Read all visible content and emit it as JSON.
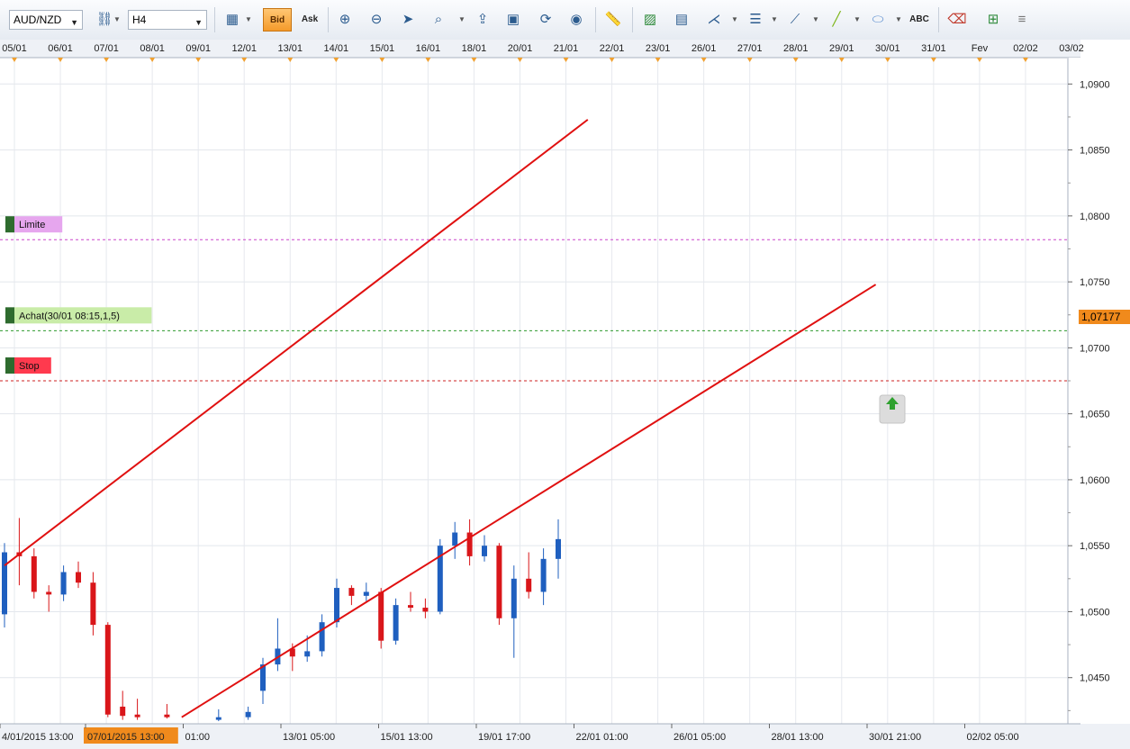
{
  "toolbar": {
    "symbol": "AUD/NZD",
    "timeframe": "H4",
    "bid_label": "Bid",
    "ask_label": "Ask",
    "text_tool_label": "ABC",
    "icons": [
      "symbol-dropdown-icon",
      "link-icon",
      "timeframe-dropdown-icon",
      "chart-type-icon",
      "bid-button",
      "ask-button",
      "zoom-in-icon",
      "zoom-out-icon",
      "cursor-icon",
      "crosshair-icon",
      "trend-tool-icon",
      "screenshot-icon",
      "refresh-icon",
      "globe-icon",
      "ruler-icon",
      "image-icon",
      "template-icon",
      "fork-icon",
      "indicators-icon",
      "draw-line-icon",
      "pencil-icon",
      "ellipse-icon",
      "text-tool-icon",
      "eraser-icon",
      "hierarchy-icon",
      "menu-icon"
    ]
  },
  "chart_data": {
    "type": "candlestick",
    "symbol": "AUD/NZD",
    "timeframe": "H4",
    "ylim": [
      1.0415,
      1.092
    ],
    "y_ticks": [
      "1,0900",
      "1,0850",
      "1,0800",
      "1,0750",
      "1,0700",
      "1,0650",
      "1,0600",
      "1,0550",
      "1,0500",
      "1,0450"
    ],
    "top_date_labels": [
      "05/01",
      "06/01",
      "07/01",
      "08/01",
      "09/01",
      "12/01",
      "13/01",
      "14/01",
      "15/01",
      "16/01",
      "18/01",
      "20/01",
      "21/01",
      "22/01",
      "23/01",
      "26/01",
      "27/01",
      "28/01",
      "29/01",
      "30/01",
      "31/01",
      "Fev",
      "02/02",
      "03/02"
    ],
    "bottom_time_labels": [
      "4/01/2015 13:00",
      "07/01/2015 13:00",
      "01:00",
      "13/01 05:00",
      "15/01 13:00",
      "19/01 17:00",
      "22/01 01:00",
      "26/01 05:00",
      "28/01 13:00",
      "30/01 21:00",
      "02/02 05:00"
    ],
    "highlighted_time": "07/01/2015 13:00",
    "current_price": "1,07177",
    "order_lines": [
      {
        "label": "Limite",
        "price": 1.0782,
        "color": "#cc44cc",
        "tag_bg": "#e6a6ee"
      },
      {
        "label": "Achat(30/01 08:15,1,5)",
        "price": 1.0713,
        "color": "#2e9a2e",
        "tag_bg": "#c9eca8"
      },
      {
        "label": "Stop",
        "price": 1.0675,
        "color": "#cc2222",
        "tag_bg": "#ff3a4e"
      }
    ],
    "trend_lines": [
      {
        "name": "upper-channel",
        "from": {
          "x": 0,
          "p": 1.0535
        },
        "to": {
          "x": 158,
          "p": 1.0873
        }
      },
      {
        "name": "lower-channel",
        "from": {
          "x": 48,
          "p": 1.042
        },
        "to": {
          "x": 236,
          "p": 1.0748
        }
      }
    ],
    "x_count": 240,
    "candles": [
      {
        "x": 0,
        "o": 1.0498,
        "h": 1.0552,
        "l": 1.0488,
        "c": 1.0545
      },
      {
        "x": 4,
        "o": 1.0545,
        "h": 1.0571,
        "l": 1.052,
        "c": 1.0542
      },
      {
        "x": 8,
        "o": 1.0542,
        "h": 1.0548,
        "l": 1.051,
        "c": 1.0515
      },
      {
        "x": 12,
        "o": 1.0515,
        "h": 1.052,
        "l": 1.05,
        "c": 1.0513
      },
      {
        "x": 16,
        "o": 1.0513,
        "h": 1.0535,
        "l": 1.0508,
        "c": 1.053
      },
      {
        "x": 20,
        "o": 1.053,
        "h": 1.0538,
        "l": 1.0518,
        "c": 1.0522
      },
      {
        "x": 24,
        "o": 1.0522,
        "h": 1.053,
        "l": 1.0482,
        "c": 1.049
      },
      {
        "x": 28,
        "o": 1.049,
        "h": 1.0492,
        "l": 1.042,
        "c": 1.0422
      },
      {
        "x": 32,
        "o": 1.0428,
        "h": 1.044,
        "l": 1.0418,
        "c": 1.0421
      },
      {
        "x": 36,
        "o": 1.0422,
        "h": 1.0434,
        "l": 1.0418,
        "c": 1.042
      },
      {
        "x": 44,
        "o": 1.0422,
        "h": 1.043,
        "l": 1.0419,
        "c": 1.042
      },
      {
        "x": 58,
        "o": 1.0418,
        "h": 1.0426,
        "l": 1.0417,
        "c": 1.042
      },
      {
        "x": 66,
        "o": 1.042,
        "h": 1.0428,
        "l": 1.0418,
        "c": 1.0424
      },
      {
        "x": 70,
        "o": 1.044,
        "h": 1.0465,
        "l": 1.043,
        "c": 1.046
      },
      {
        "x": 74,
        "o": 1.046,
        "h": 1.0495,
        "l": 1.0455,
        "c": 1.0472
      },
      {
        "x": 78,
        "o": 1.0472,
        "h": 1.0476,
        "l": 1.0455,
        "c": 1.0466
      },
      {
        "x": 82,
        "o": 1.0466,
        "h": 1.0482,
        "l": 1.0462,
        "c": 1.047
      },
      {
        "x": 86,
        "o": 1.047,
        "h": 1.0498,
        "l": 1.0466,
        "c": 1.0492
      },
      {
        "x": 90,
        "o": 1.0492,
        "h": 1.0525,
        "l": 1.0488,
        "c": 1.0518
      },
      {
        "x": 94,
        "o": 1.0518,
        "h": 1.052,
        "l": 1.0505,
        "c": 1.0512
      },
      {
        "x": 98,
        "o": 1.0512,
        "h": 1.0522,
        "l": 1.0508,
        "c": 1.0515
      },
      {
        "x": 102,
        "o": 1.0515,
        "h": 1.0518,
        "l": 1.0472,
        "c": 1.0478
      },
      {
        "x": 106,
        "o": 1.0478,
        "h": 1.051,
        "l": 1.0475,
        "c": 1.0505
      },
      {
        "x": 110,
        "o": 1.0505,
        "h": 1.0515,
        "l": 1.05,
        "c": 1.0503
      },
      {
        "x": 114,
        "o": 1.0503,
        "h": 1.051,
        "l": 1.0495,
        "c": 1.05
      },
      {
        "x": 118,
        "o": 1.05,
        "h": 1.0555,
        "l": 1.0498,
        "c": 1.055
      },
      {
        "x": 122,
        "o": 1.055,
        "h": 1.0568,
        "l": 1.054,
        "c": 1.056
      },
      {
        "x": 126,
        "o": 1.056,
        "h": 1.057,
        "l": 1.0535,
        "c": 1.0542
      },
      {
        "x": 130,
        "o": 1.0542,
        "h": 1.0558,
        "l": 1.0538,
        "c": 1.055
      },
      {
        "x": 134,
        "o": 1.055,
        "h": 1.0552,
        "l": 1.049,
        "c": 1.0495
      },
      {
        "x": 138,
        "o": 1.0495,
        "h": 1.0535,
        "l": 1.0465,
        "c": 1.0525
      },
      {
        "x": 142,
        "o": 1.0525,
        "h": 1.0545,
        "l": 1.051,
        "c": 1.0515
      },
      {
        "x": 146,
        "o": 1.0515,
        "h": 1.0548,
        "l": 1.0505,
        "c": 1.054
      },
      {
        "x": 150,
        "o": 1.054,
        "h": 1.057,
        "l": 1.0525,
        "c": 1.0555
      }
    ]
  }
}
